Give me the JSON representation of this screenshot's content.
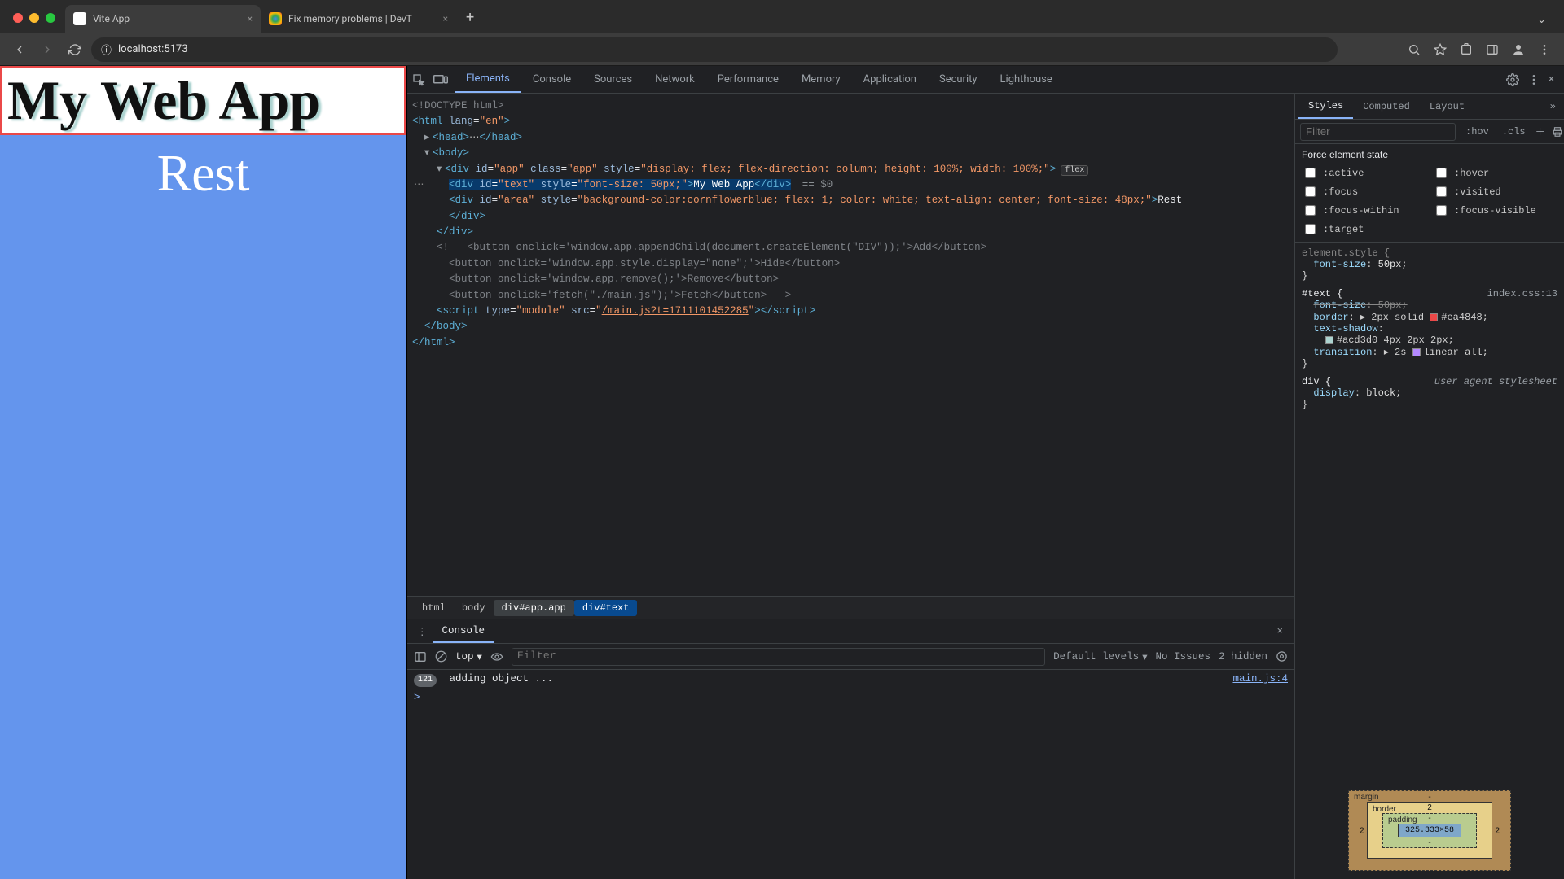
{
  "browser": {
    "tabs": [
      {
        "title": "Vite App",
        "active": true
      },
      {
        "title": "Fix memory problems | DevT",
        "active": false
      }
    ],
    "url": "localhost:5173"
  },
  "page": {
    "title": "My Web App",
    "rest": "Rest"
  },
  "devtools": {
    "tabs": [
      "Elements",
      "Console",
      "Sources",
      "Network",
      "Performance",
      "Memory",
      "Application",
      "Security",
      "Lighthouse"
    ],
    "active_tab": "Elements",
    "dom": {
      "doctype": "<!DOCTYPE html>",
      "html_open": "<html lang=\"en\">",
      "head": "<head>…</head>",
      "body_open": "<body>",
      "app_div": "<div id=\"app\" class=\"app\" style=\"display: flex; flex-direction: column; height: 100%; width: 100%;\">",
      "flex_badge": "flex",
      "text_div_open": "<div id=\"text\" style=\"",
      "text_div_style": "font-size: 50px;",
      "text_div_close": "\">My Web App</div>",
      "selected_suffix": " == $0",
      "area_div": "<div id=\"area\" style=\"background-color:cornflowerblue; flex: 1; color: white; text-align: center; font-size: 48px;\">Rest</div>",
      "close_div1": "</div>",
      "comment": "<!-- <button onclick='window.app.appendChild(document.createElement(\"DIV\"));'>Add</button>",
      "comment2": "<button onclick='window.app.style.display=\"none\";'>Hide</button>",
      "comment3": "<button onclick='window.app.remove();'>Remove</button>",
      "comment4": "<button onclick='fetch(\"./main.js\");'>Fetch</button> -->",
      "script": "<script type=\"module\" src=\"/main.js?t=1711101452285\"></script>",
      "close_body": "</body>",
      "close_html": "</html>"
    },
    "crumbs": [
      "html",
      "body",
      "div#app.app",
      "div#text"
    ],
    "styles": {
      "tabs": [
        "Styles",
        "Computed",
        "Layout"
      ],
      "filter_placeholder": "Filter",
      "toggles": {
        "hov": ":hov",
        "cls": ".cls"
      },
      "force_title": "Force element state",
      "states": [
        ":active",
        ":hover",
        ":focus",
        ":visited",
        ":focus-within",
        ":focus-visible",
        ":target"
      ],
      "rules": {
        "element_style": {
          "selector": "element.style {",
          "props": [
            {
              "p": "font-size",
              "v": "50px;"
            }
          ],
          "close": "}"
        },
        "text_rule": {
          "selector": "#text {",
          "source": "index.css:13",
          "props": [
            {
              "p": "font-size",
              "v": "50px;",
              "strike": true
            },
            {
              "p": "border",
              "v": "▸ 2px solid ",
              "swatch": "#ea4848",
              "swtext": "#ea4848;"
            },
            {
              "p": "text-shadow",
              "v": "",
              "cont": true
            },
            {
              "p": "",
              "v": "",
              "sw1": "#acd3d0",
              "sw1t": "#acd3d0 4px 2px 2px;",
              "indent": true
            },
            {
              "p": "transition",
              "v": "▸ 2s ",
              "sw2": true,
              "sw2t": "linear all;"
            }
          ],
          "close": "}"
        },
        "div_rule": {
          "selector": "div {",
          "uas": "user agent stylesheet",
          "props": [
            {
              "p": "display",
              "v": "block;"
            }
          ],
          "close": "}"
        }
      },
      "boxmodel": {
        "margin": "margin",
        "border": "border",
        "padding": "padding",
        "content_size": "325.333×58",
        "border_val": "2",
        "dash": "-"
      }
    },
    "console": {
      "tab": "Console",
      "context": "top",
      "filter_placeholder": "Filter",
      "levels": "Default levels",
      "issues": "No Issues",
      "hidden": "2 hidden",
      "badge": "121",
      "message": "adding object ...",
      "source": "main.js:4",
      "prompt": ">"
    }
  }
}
